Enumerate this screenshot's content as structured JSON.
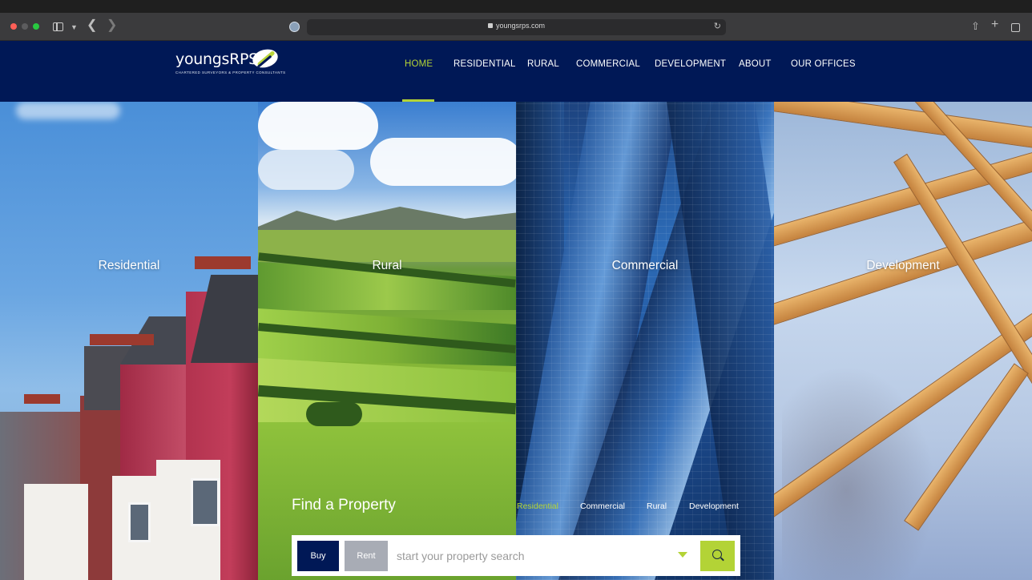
{
  "browser": {
    "url": "youngsrps.com"
  },
  "logo": {
    "name": "youngsRPS",
    "tagline": "CHARTERED SURVEYORS & PROPERTY CONSULTANTS"
  },
  "nav": {
    "items": [
      {
        "label": "HOME",
        "active": true
      },
      {
        "label": "RESIDENTIAL",
        "active": false
      },
      {
        "label": "RURAL",
        "active": false
      },
      {
        "label": "COMMERCIAL",
        "active": false
      },
      {
        "label": "DEVELOPMENT",
        "active": false
      },
      {
        "label": "ABOUT",
        "active": false
      },
      {
        "label": "OUR OFFICES",
        "active": false
      }
    ],
    "accent_color": "#b3d336",
    "background_color": "#001856"
  },
  "panels": [
    {
      "label": "Residential"
    },
    {
      "label": "Rural"
    },
    {
      "label": "Commercial"
    },
    {
      "label": "Development"
    }
  ],
  "search": {
    "title": "Find a Property",
    "tabs": [
      {
        "label": "Residential",
        "active": true
      },
      {
        "label": "Commercial",
        "active": false
      },
      {
        "label": "Rural",
        "active": false
      },
      {
        "label": "Development",
        "active": false
      }
    ],
    "buy_label": "Buy",
    "rent_label": "Rent",
    "placeholder": "start your property search",
    "search_icon": "search-icon",
    "dropdown_icon": "caret-down-icon"
  }
}
